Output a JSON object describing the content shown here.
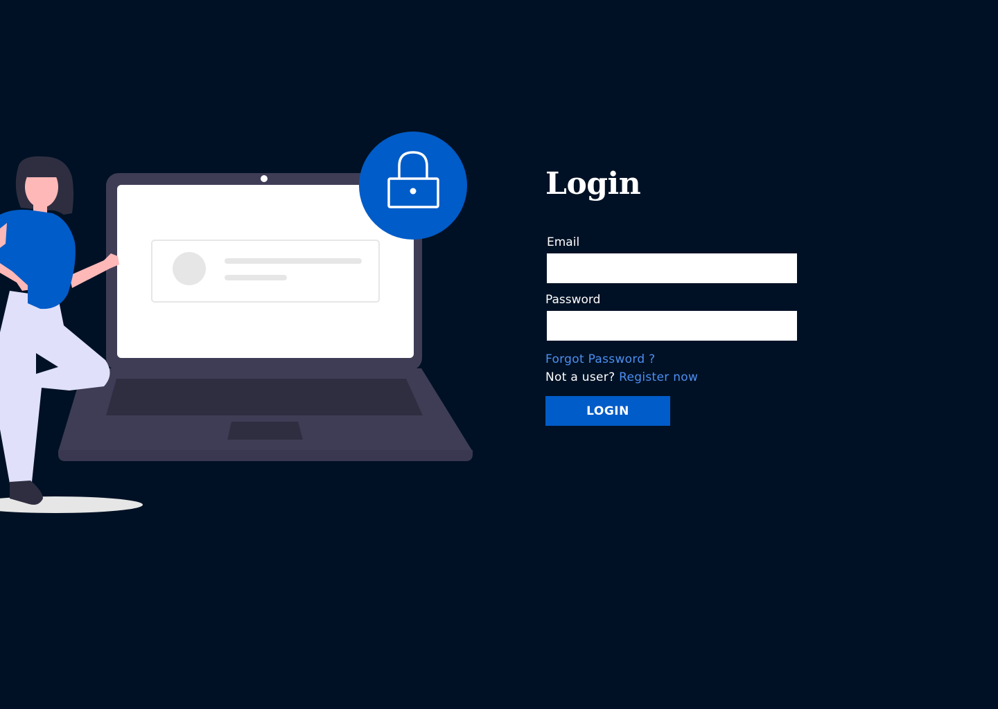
{
  "colors": {
    "background": "#001125",
    "accent": "#005cc8",
    "link": "#4d8ff1",
    "laptop_body": "#3f3d56",
    "shirt": "#005cc8",
    "pants": "#e0e0fa",
    "skin": "#ffb8b8"
  },
  "illustration": {
    "icons": [
      "lock-icon",
      "laptop-icon",
      "person-figure"
    ]
  },
  "login": {
    "title": "Login",
    "email_label": "Email",
    "email_value": "",
    "password_label": "Password",
    "password_value": "",
    "forgot_password": "Forgot Password ?",
    "not_user_text": "Not a user?",
    "register_link": "Register now",
    "button_label": "LOGIN"
  }
}
